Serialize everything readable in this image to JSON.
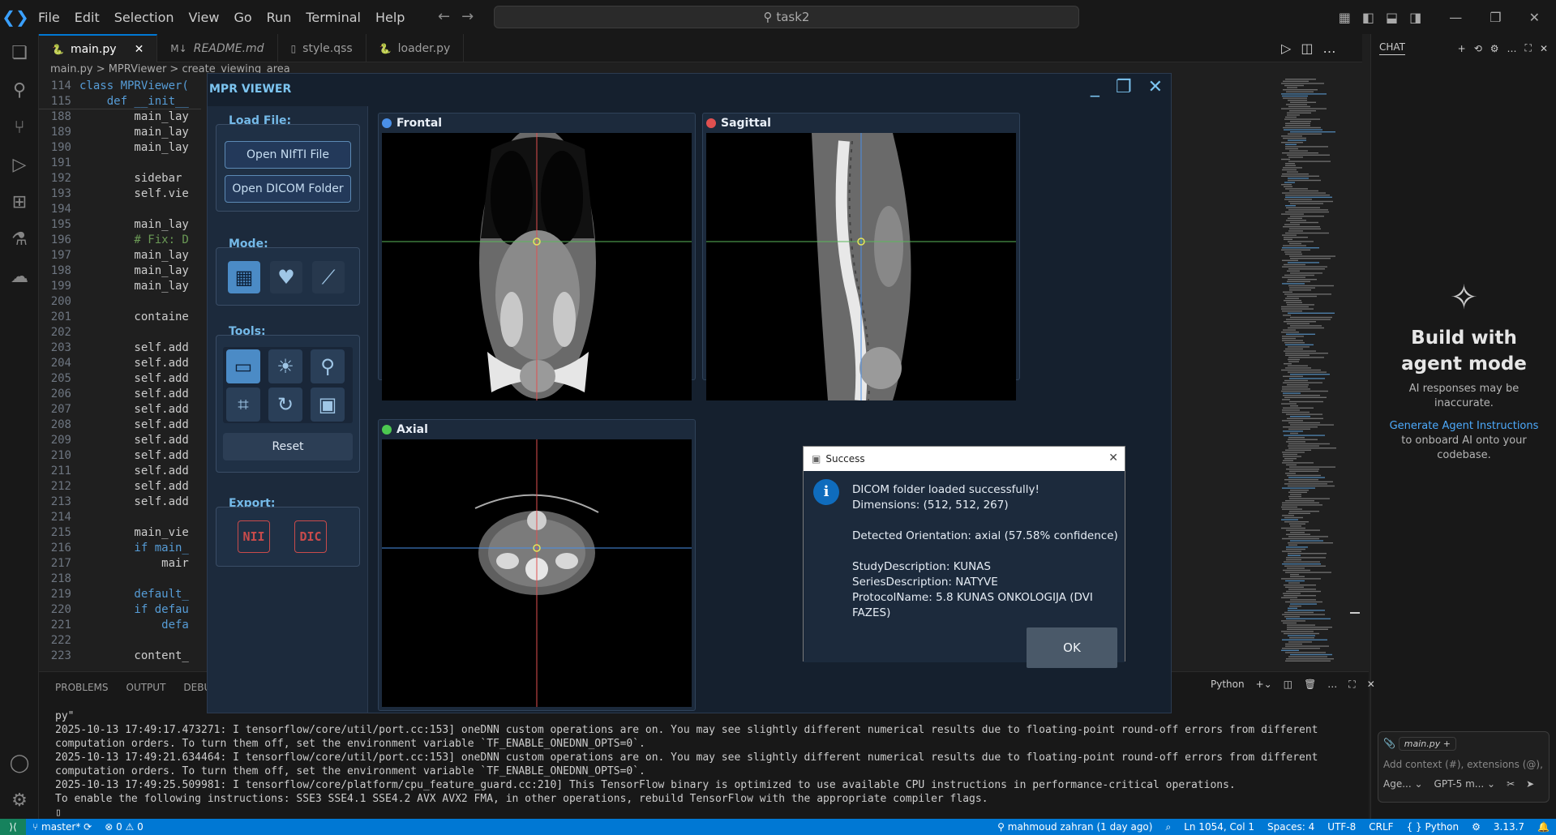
{
  "titlebar": {
    "menu": [
      "File",
      "Edit",
      "Selection",
      "View",
      "Go",
      "Run",
      "Terminal",
      "Help"
    ],
    "search": "task2"
  },
  "tabs": [
    {
      "label": "main.py",
      "icon": "python-icon",
      "active": true
    },
    {
      "label": "README.md",
      "icon": "markdown-icon",
      "active": false
    },
    {
      "label": "style.qss",
      "icon": "file-icon",
      "active": false
    },
    {
      "label": "loader.py",
      "icon": "python-icon",
      "active": false
    }
  ],
  "breadcrumb": "main.py > MPRViewer > create_viewing_area",
  "code": {
    "lines": [
      {
        "n": "114",
        "t": "class MPRViewer("
      },
      {
        "n": "115",
        "t": "    def __init__"
      },
      {
        "n": "188",
        "t": "        main_lay"
      },
      {
        "n": "189",
        "t": "        main_lay"
      },
      {
        "n": "190",
        "t": "        main_lay"
      },
      {
        "n": "191",
        "t": ""
      },
      {
        "n": "192",
        "t": "        sidebar"
      },
      {
        "n": "193",
        "t": "        self.vie"
      },
      {
        "n": "194",
        "t": ""
      },
      {
        "n": "195",
        "t": "        main_lay"
      },
      {
        "n": "196",
        "t": "        # Fix: D"
      },
      {
        "n": "197",
        "t": "        main_lay"
      },
      {
        "n": "198",
        "t": "        main_lay"
      },
      {
        "n": "199",
        "t": "        main_lay"
      },
      {
        "n": "200",
        "t": ""
      },
      {
        "n": "201",
        "t": "        containe"
      },
      {
        "n": "202",
        "t": ""
      },
      {
        "n": "203",
        "t": "        self.add"
      },
      {
        "n": "204",
        "t": "        self.add"
      },
      {
        "n": "205",
        "t": "        self.add"
      },
      {
        "n": "206",
        "t": "        self.add"
      },
      {
        "n": "207",
        "t": "        self.add"
      },
      {
        "n": "208",
        "t": "        self.add"
      },
      {
        "n": "209",
        "t": "        self.add"
      },
      {
        "n": "210",
        "t": "        self.add"
      },
      {
        "n": "211",
        "t": "        self.add"
      },
      {
        "n": "212",
        "t": "        self.add"
      },
      {
        "n": "213",
        "t": "        self.add"
      },
      {
        "n": "214",
        "t": ""
      },
      {
        "n": "215",
        "t": "        main_vie"
      },
      {
        "n": "216",
        "t": "        if main_"
      },
      {
        "n": "217",
        "t": "            mair"
      },
      {
        "n": "218",
        "t": ""
      },
      {
        "n": "219",
        "t": "        default_"
      },
      {
        "n": "220",
        "t": "        if defau"
      },
      {
        "n": "221",
        "t": "            defa"
      },
      {
        "n": "222",
        "t": ""
      },
      {
        "n": "223",
        "t": "        content_"
      }
    ]
  },
  "panel": {
    "tabs": [
      "PROBLEMS",
      "OUTPUT",
      "DEBUG"
    ],
    "language": "Python",
    "terminal": [
      "py\"",
      "2025-10-13 17:49:17.473271: I tensorflow/core/util/port.cc:153] oneDNN custom operations are on. You may see slightly different numerical results due to floating-point round-off errors from different computation orders. To turn them off, set the environment variable `TF_ENABLE_ONEDNN_OPTS=0`.",
      "2025-10-13 17:49:21.634464: I tensorflow/core/util/port.cc:153] oneDNN custom operations are on. You may see slightly different numerical results due to floating-point round-off errors from different computation orders. To turn them off, set the environment variable `TF_ENABLE_ONEDNN_OPTS=0`.",
      "2025-10-13 17:49:25.509981: I tensorflow/core/platform/cpu_feature_guard.cc:210] This TensorFlow binary is optimized to use available CPU instructions in performance-critical operations.",
      "To enable the following instructions: SSE3 SSE4.1 SSE4.2 AVX AVX2 FMA, in other operations, rebuild TensorFlow with the appropriate compiler flags.",
      "▯"
    ]
  },
  "chat": {
    "title": "CHAT",
    "heading": "Build with agent mode",
    "note": "AI responses may be inaccurate.",
    "link": "Generate Agent Instructions",
    "instr_suffix": " to onboard AI onto your codebase.",
    "chip": "main.py",
    "placeholder": "Add context (#), extensions (@), c",
    "agent": "Age...",
    "model": "GPT-5 m..."
  },
  "statusbar": {
    "branch": "master*",
    "errors": "0",
    "warnings": "0",
    "author": "mahmoud zahran (1 day ago)",
    "position": "Ln 1054, Col 1",
    "spaces": "Spaces: 4",
    "encoding": "UTF-8",
    "eol": "CRLF",
    "language": "Python",
    "version": "3.13.7"
  },
  "mpr": {
    "title": "MPR VIEWER",
    "load_label": "Load File:",
    "open_nifti": "Open NIfTI File",
    "open_dicom": "Open DICOM Folder",
    "mode_label": "Mode:",
    "tools_label": "Tools:",
    "reset": "Reset",
    "export_label": "Export:",
    "export_nii": "NII",
    "export_dic": "DIC",
    "views": [
      {
        "title": "Frontal",
        "color": "#4a8fe7"
      },
      {
        "title": "Sagittal",
        "color": "#e05050"
      },
      {
        "title": "Axial",
        "color": "#4cc850"
      }
    ],
    "crosshair": {
      "horizontal": "#5ab85a",
      "vertical_frontal": "#e05050",
      "vertical_sagittal": "#4a8fe7",
      "marker": "#e5e55a"
    }
  },
  "dialog": {
    "title": "Success",
    "line1": "DICOM folder loaded successfully!",
    "line2": "Dimensions: (512, 512, 267)",
    "line3": "Detected Orientation: axial (57.58% confidence)",
    "line4": "StudyDescription: KUNAS",
    "line5": "SeriesDescription: NATYVE",
    "line6": "ProtocolName: 5.8 KUNAS ONKOLOGIJA (DVI FAZES)",
    "ok": "OK"
  }
}
